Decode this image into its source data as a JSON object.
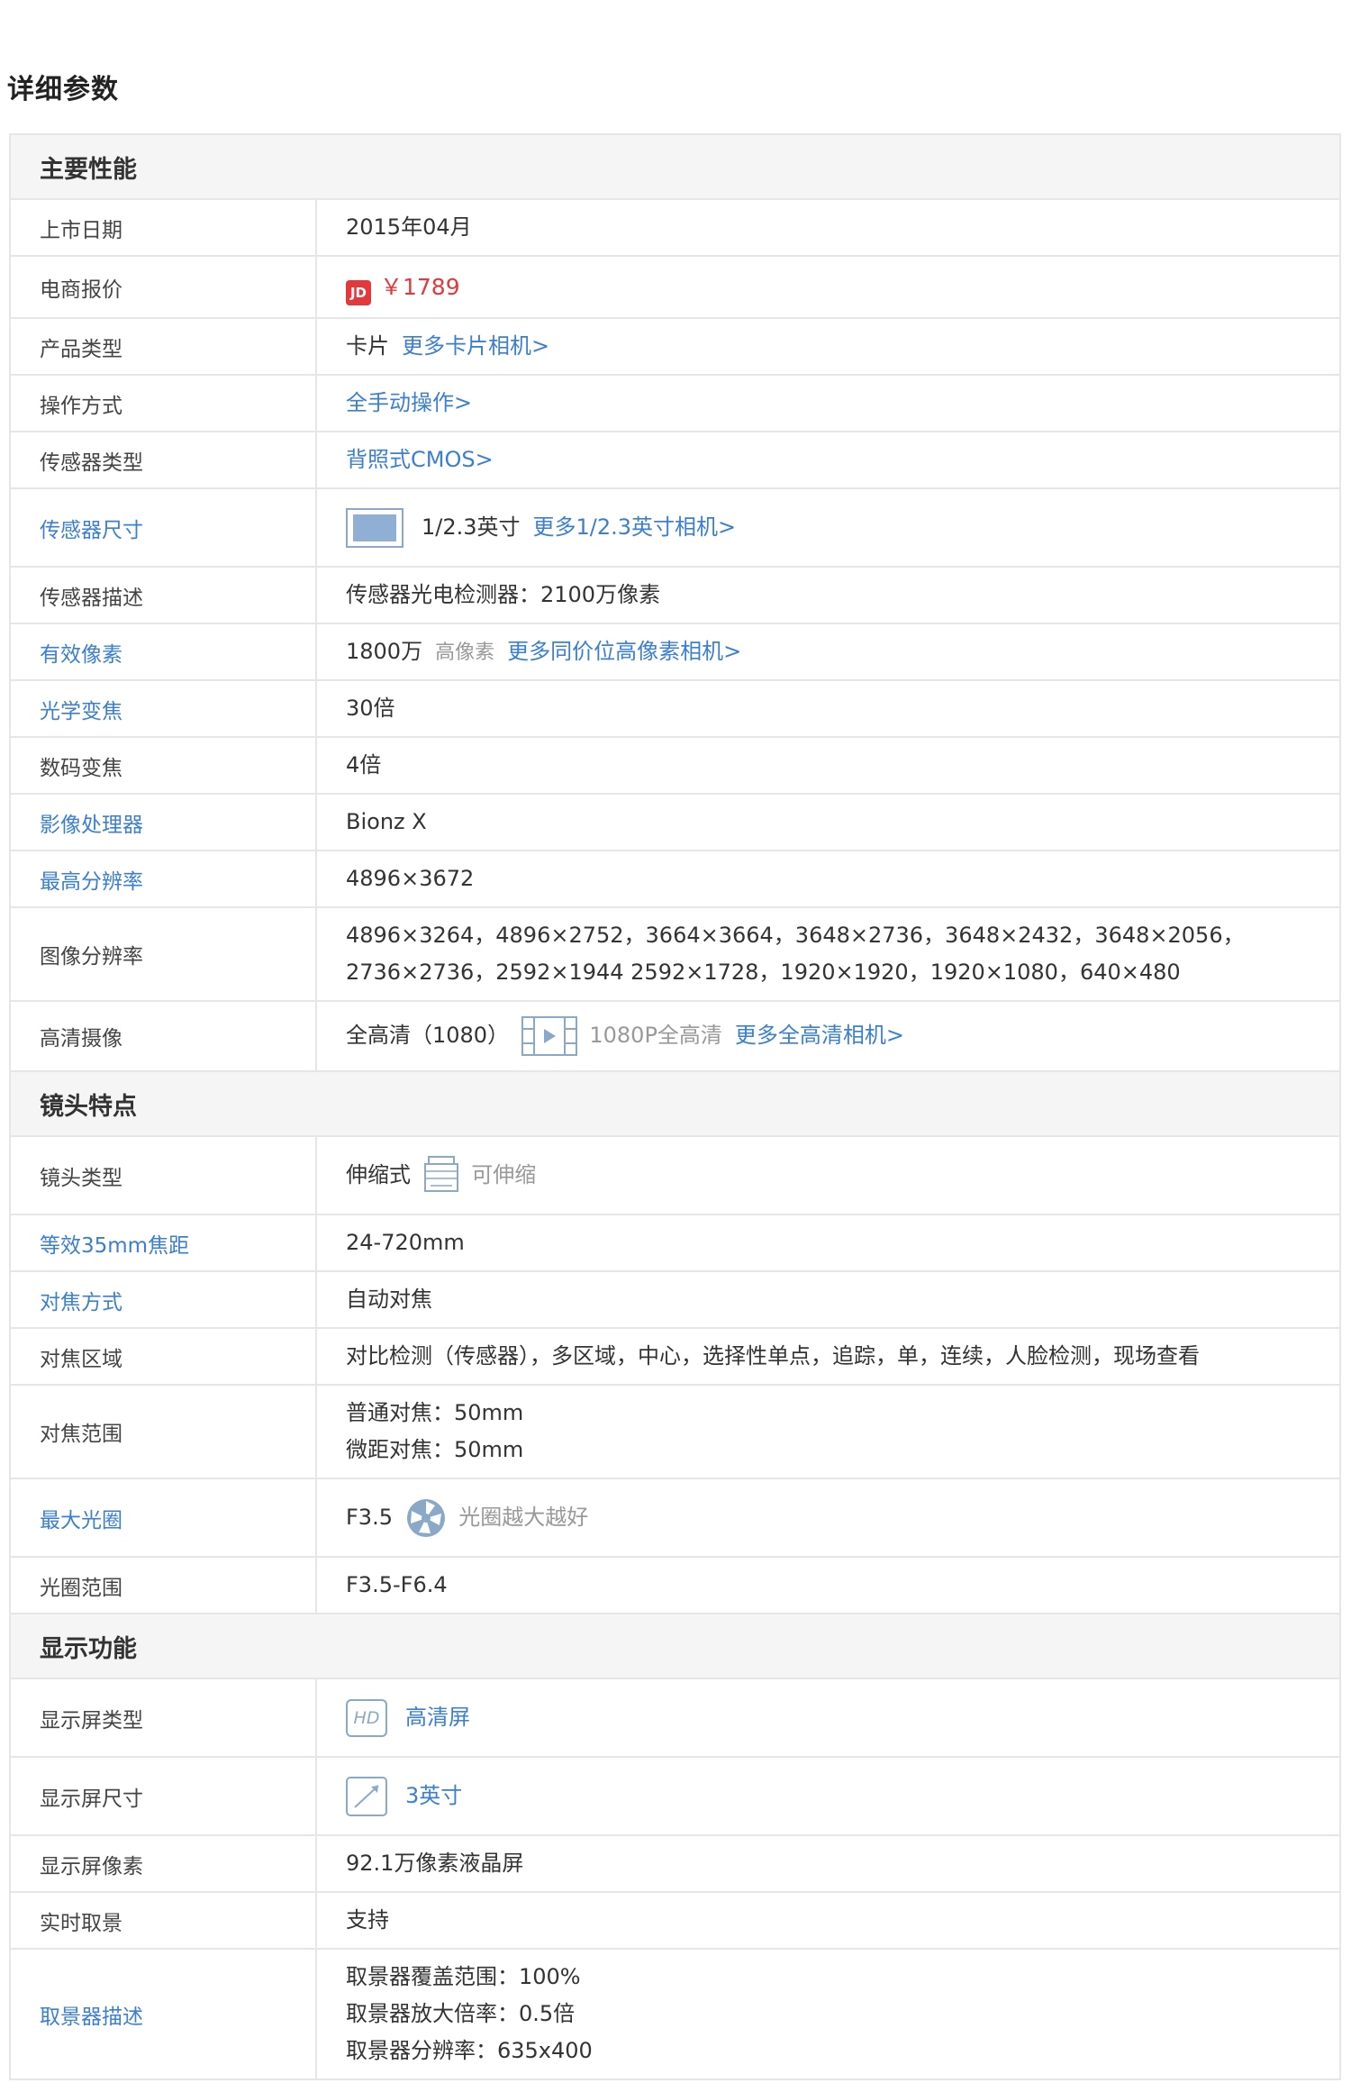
{
  "page_title": "详细参数",
  "sections": {
    "main": {
      "title": "主要性能",
      "launch_date": {
        "label": "上市日期",
        "value": "2015年04月"
      },
      "ecommerce_price": {
        "label": "电商报价",
        "badge": "JD",
        "price": "￥1789"
      },
      "product_type": {
        "label": "产品类型",
        "value": "卡片",
        "link": "更多卡片相机>"
      },
      "operation": {
        "label": "操作方式",
        "link": "全手动操作>"
      },
      "sensor_type": {
        "label": "传感器类型",
        "link": "背照式CMOS>"
      },
      "sensor_size": {
        "label": "传感器尺寸",
        "value": "1/2.3英寸",
        "link": "更多1/2.3英寸相机>"
      },
      "sensor_desc": {
        "label": "传感器描述",
        "value": "传感器光电检测器：2100万像素"
      },
      "effective_pixels": {
        "label": "有效像素",
        "value": "1800万",
        "note": "高像素",
        "link": "更多同价位高像素相机>"
      },
      "optical_zoom": {
        "label": "光学变焦",
        "value": "30倍"
      },
      "digital_zoom": {
        "label": "数码变焦",
        "value": "4倍"
      },
      "image_processor": {
        "label": "影像处理器",
        "value": "Bionz X"
      },
      "max_resolution": {
        "label": "最高分辨率",
        "value": "4896×3672"
      },
      "image_resolution": {
        "label": "图像分辨率",
        "line1": "4896×3264，4896×2752，3664×3664，3648×2736，3648×2432，3648×2056，",
        "line2": "2736×2736，2592×1944 2592×1728，1920×1920，1920×1080，640×480"
      },
      "hd_video": {
        "label": "高清摄像",
        "value": "全高清（1080）",
        "note": "1080P全高清",
        "link": "更多全高清相机>"
      }
    },
    "lens": {
      "title": "镜头特点",
      "lens_type": {
        "label": "镜头类型",
        "value": "伸缩式",
        "note": "可伸缩"
      },
      "focal_35mm": {
        "label": "等效35mm焦距",
        "value": "24-720mm"
      },
      "focus_mode": {
        "label": "对焦方式",
        "value": "自动对焦"
      },
      "focus_area": {
        "label": "对焦区域",
        "value": "对比检测（传感器），多区域，中心，选择性单点，追踪，单，连续，人脸检测，现场查看"
      },
      "focus_range": {
        "label": "对焦范围",
        "line1": "普通对焦：50mm",
        "line2": "微距对焦：50mm"
      },
      "max_aperture": {
        "label": "最大光圈",
        "value": "F3.5",
        "note": "光圈越大越好"
      },
      "aperture_range": {
        "label": "光圈范围",
        "value": "F3.5-F6.4"
      }
    },
    "display": {
      "title": "显示功能",
      "screen_type": {
        "label": "显示屏类型",
        "icon_text": "HD",
        "link": "高清屏"
      },
      "screen_size": {
        "label": "显示屏尺寸",
        "link": "3英寸"
      },
      "screen_pixels": {
        "label": "显示屏像素",
        "value": "92.1万像素液晶屏"
      },
      "live_view": {
        "label": "实时取景",
        "value": "支持"
      },
      "viewfinder_desc": {
        "label": "取景器描述",
        "line1": "取景器覆盖范围：100%",
        "line2": "取景器放大倍率：0.5倍",
        "line3": "取景器分辨率：635x400"
      }
    }
  },
  "colors": {
    "link": "#3b7fd0",
    "price": "#e4393c",
    "section_bg": "#f5f5f5",
    "border": "#e6e6e6"
  }
}
